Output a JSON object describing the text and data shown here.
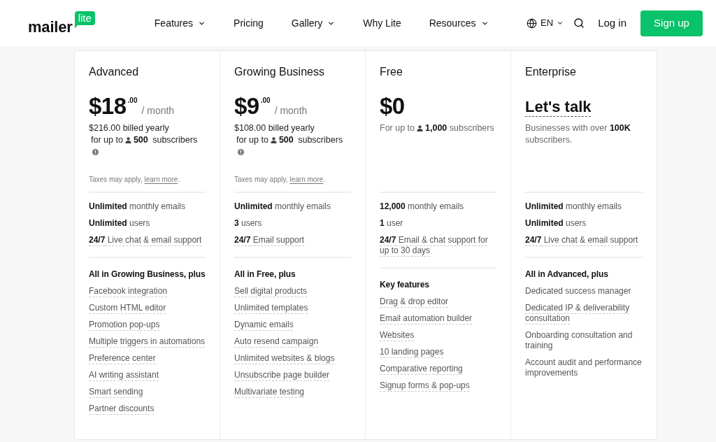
{
  "header": {
    "logo": {
      "text": "mailer",
      "badge": "lite"
    },
    "nav": [
      {
        "label": "Features",
        "has_menu": true
      },
      {
        "label": "Pricing",
        "has_menu": false
      },
      {
        "label": "Gallery",
        "has_menu": true
      },
      {
        "label": "Why Lite",
        "has_menu": false
      },
      {
        "label": "Resources",
        "has_menu": true
      }
    ],
    "language": {
      "label": "EN"
    },
    "login": "Log in",
    "signup": "Sign up"
  },
  "plans": [
    {
      "name": "Advanced",
      "price": {
        "kind": "amount",
        "amount": "$18",
        "cents": ".00",
        "period": "/ month"
      },
      "billed": "$216.00 billed yearly",
      "subscribers": {
        "prefix": "for up to",
        "count": "500",
        "suffix": "subscribers"
      },
      "info": true,
      "taxes": {
        "text": "Taxes may apply,",
        "link": "learn more",
        "end": "."
      },
      "stats": [
        {
          "text": "**Unlimited** monthly emails",
          "underlined": false
        },
        {
          "text": "**Unlimited** users",
          "underlined": false
        },
        {
          "text": "**24/7** Live chat & email support",
          "underlined": true
        }
      ],
      "features_heading": "All in Growing Business, plus",
      "features": [
        {
          "text": "Facebook integration",
          "underlined": true
        },
        {
          "text": "Custom HTML editor",
          "underlined": true
        },
        {
          "text": "Promotion pop-ups",
          "underlined": true
        },
        {
          "text": "Multiple triggers in automations",
          "underlined": true
        },
        {
          "text": "Preference center",
          "underlined": true
        },
        {
          "text": "AI writing assistant",
          "underlined": true
        },
        {
          "text": "Smart sending",
          "underlined": true
        },
        {
          "text": "Partner discounts",
          "underlined": true
        }
      ]
    },
    {
      "name": "Growing Business",
      "price": {
        "kind": "amount",
        "amount": "$9",
        "cents": ".00",
        "period": "/ month"
      },
      "billed": "$108.00 billed yearly",
      "subscribers": {
        "prefix": "for up to",
        "count": "500",
        "suffix": "subscribers"
      },
      "info": true,
      "taxes": {
        "text": "Taxes may apply,",
        "link": "learn more",
        "end": "."
      },
      "stats": [
        {
          "text": "**Unlimited** monthly emails",
          "underlined": false
        },
        {
          "text": "**3** users",
          "underlined": false
        },
        {
          "text": "**24/7** Email support",
          "underlined": true
        }
      ],
      "features_heading": "All in Free, plus",
      "features": [
        {
          "text": "Sell digital products",
          "underlined": true
        },
        {
          "text": "Unlimited templates",
          "underlined": true
        },
        {
          "text": "Dynamic emails",
          "underlined": true
        },
        {
          "text": "Auto resend campaign",
          "underlined": true
        },
        {
          "text": "Unlimited websites & blogs",
          "underlined": true
        },
        {
          "text": "Unsubscribe page builder",
          "underlined": true
        },
        {
          "text": "Multivariate testing",
          "underlined": true
        }
      ]
    },
    {
      "name": "Free",
      "price": {
        "kind": "amount",
        "amount": "$0"
      },
      "subscribers": {
        "prefix": "For up to",
        "count": "1,000",
        "suffix": "subscribers"
      },
      "info": false,
      "stats": [
        {
          "text": "**12,000** monthly emails",
          "underlined": false
        },
        {
          "text": "**1** user",
          "underlined": false
        },
        {
          "text": "**24/7** Email & chat support for up to 30 days",
          "underlined": true
        }
      ],
      "features_heading": "Key features",
      "features": [
        {
          "text": "Drag & drop editor",
          "underlined": true
        },
        {
          "text": "Email automation builder",
          "underlined": true
        },
        {
          "text": "Websites",
          "underlined": true
        },
        {
          "text": "10 landing pages",
          "underlined": true
        },
        {
          "text": "Comparative reporting",
          "underlined": true
        },
        {
          "text": "Signup forms & pop-ups",
          "underlined": true
        }
      ]
    },
    {
      "name": "Enterprise",
      "price": {
        "kind": "contact",
        "text": "Let's talk"
      },
      "description": "Businesses with over **100K** subscribers.",
      "info": false,
      "stats": [
        {
          "text": "**Unlimited** monthly emails",
          "underlined": false
        },
        {
          "text": "**Unlimited** users",
          "underlined": false
        },
        {
          "text": "**24/7** Live chat & email support",
          "underlined": true
        }
      ],
      "features_heading": "All in Advanced, plus",
      "features": [
        {
          "text": "Dedicated success manager",
          "underlined": false
        },
        {
          "text": "Dedicated IP & deliverability consultation",
          "underlined": true
        },
        {
          "text": "Onboarding consultation and training",
          "underlined": false
        },
        {
          "text": "Account audit and performance improvements",
          "underlined": false
        }
      ]
    }
  ]
}
